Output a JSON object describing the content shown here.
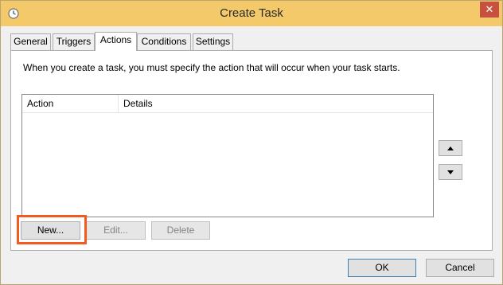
{
  "window": {
    "title": "Create Task",
    "title_icon": "clock-icon",
    "close_label": "✕"
  },
  "tabs": [
    {
      "label": "General",
      "active": false
    },
    {
      "label": "Triggers",
      "active": false
    },
    {
      "label": "Actions",
      "active": true
    },
    {
      "label": "Conditions",
      "active": false
    },
    {
      "label": "Settings",
      "active": false
    }
  ],
  "actions_panel": {
    "description": "When you create a task, you must specify the action that will occur when your task starts.",
    "list": {
      "columns": [
        "Action",
        "Details"
      ],
      "rows": []
    },
    "move_up_icon": "triangle-up-icon",
    "move_down_icon": "triangle-down-icon",
    "buttons": {
      "new_label": "New...",
      "edit_label": "Edit...",
      "delete_label": "Delete"
    }
  },
  "footer": {
    "ok_label": "OK",
    "cancel_label": "Cancel"
  },
  "colors": {
    "titlebar": "#f3c96a",
    "close_button": "#c7503f",
    "highlight_border": "#f25a1f"
  }
}
